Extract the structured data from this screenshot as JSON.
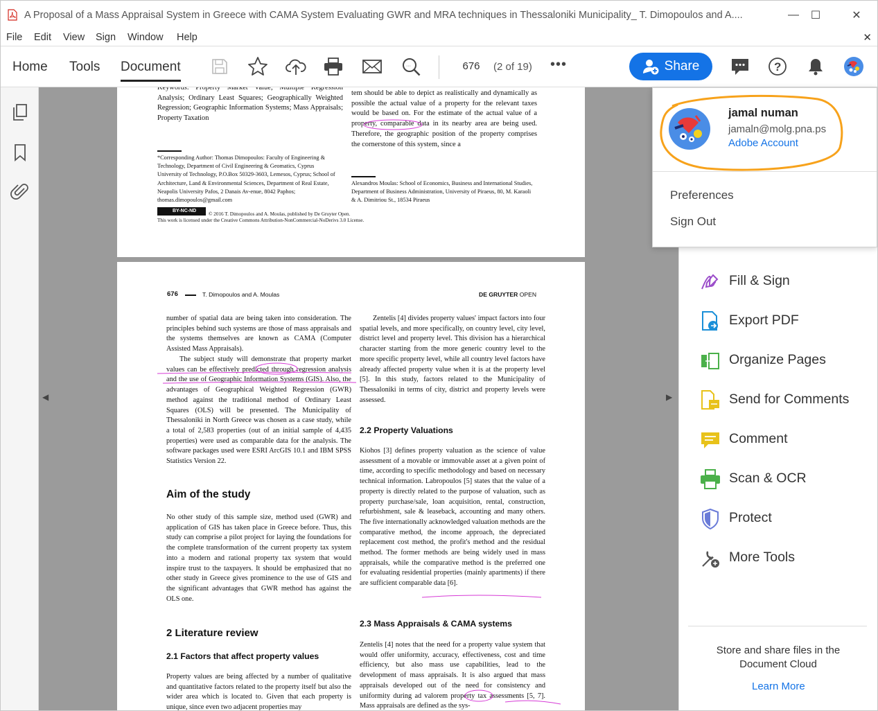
{
  "window": {
    "title": "A Proposal of a Mass Appraisal System in Greece with CAMA System Evaluating GWR and MRA techniques in Thessaloniki Municipality_ T. Dimopoulos and A....",
    "minimize": "—",
    "maximize": "☐",
    "close": "✕"
  },
  "menu": {
    "items": [
      "File",
      "Edit",
      "View",
      "Sign",
      "Window",
      "Help"
    ],
    "close_doc": "✕"
  },
  "toolbar": {
    "tabs": [
      "Home",
      "Tools",
      "Document"
    ],
    "active_tab": "Document",
    "page_number": "676",
    "page_count": "(2 of 19)",
    "more": "•••",
    "share_label": "Share"
  },
  "account_popup": {
    "name": "jamal numan",
    "email": "jamaln@molg.pna.ps",
    "account_link": "Adobe Account",
    "preferences": "Preferences",
    "sign_out": "Sign Out",
    "highlight_color": "#f7a21b"
  },
  "tools_panel": {
    "items": [
      {
        "label": "Fill & Sign",
        "icon": "fill-sign-icon",
        "color": "#9b4dca"
      },
      {
        "label": "Export PDF",
        "icon": "export-pdf-icon",
        "color": "#1a8fd8"
      },
      {
        "label": "Organize Pages",
        "icon": "organize-pages-icon",
        "color": "#4bb04a"
      },
      {
        "label": "Send for Comments",
        "icon": "send-comments-icon",
        "color": "#e8c21a"
      },
      {
        "label": "Comment",
        "icon": "comment-icon",
        "color": "#e8c21a"
      },
      {
        "label": "Scan & OCR",
        "icon": "scan-ocr-icon",
        "color": "#4bb04a"
      },
      {
        "label": "Protect",
        "icon": "protect-icon",
        "color": "#6a7bd8"
      },
      {
        "label": "More Tools",
        "icon": "more-tools-icon",
        "color": "#555555"
      }
    ],
    "cloud_text": "Store and share files in the Document Cloud",
    "learn_more": "Learn More"
  },
  "page1": {
    "keywords": "Keywords: Property Market Value; Multiple Regression Analysis; Ordinary Least Squares; Geographically Weighted Regression; Geographic Information Systems; Mass Appraisals; Property Taxation",
    "right_text": "tem should be able to depict as realistically and dynamically as possible the actual value of a property for the relevant taxes would be based on. For the estimate of the actual value of a property, comparable data in its nearby area are being used. Therefore, the geographic position of the property comprises the cornerstone of this system, since a",
    "corr_author": "*Corresponding Author: Thomas Dimopoulos: Faculty of Engineering & Technology, Department of Civil Engineering & Geomatics, Cyprus University of Technology, P.O.Box 50329-3603, Lemesos, Cyprus; School of Architecture, Land & Environmental Sciences, Department of Real Estate, Neapolis University Pafos, 2 Danais Av-enue, 8042 Paphos; thomas.dimopoulos@gmail.com",
    "second_author": "Alexandros Moulas: School of Economics, Business and International Studies, Department of Business Administration, University of Piraeus, 80, M. Karaoli & A. Dimitriou St., 18534 Piraeus",
    "license_badge": "BY-NC-ND",
    "license_line1": "© 2016 T. Dimopoulos and A. Moulas, published by De Gruyter Open.",
    "license_line2": "This work is licensed under the Creative Commons Attribution-NonCommercial-NoDerivs 3.0 License."
  },
  "page2": {
    "page_num": "676",
    "authors": "T. Dimopoulos and A. Moulas",
    "publisher_bold": "DE GRUYTER",
    "publisher_light": "OPEN",
    "left_p1": "number of spatial data are being taken into consideration. The principles behind such systems are those of mass appraisals and the systems themselves are known as CAMA (Computer Assisted Mass Appraisals).",
    "left_p2": "The subject study will demonstrate that property market values can be effectively predicted through regression analysis and the use of Geographic Information Systems (GIS). Also, the advantages of Geographical Weighted Regression (GWR) method against the traditional method of Ordinary Least Squares (OLS) will be presented. The Municipality of Thessaloniki in North Greece was chosen as a case study, while a total of 2,583 properties (out of an initial sample of 4,435 properties) were used as comparable data for the analysis. The software packages used were ESRI ArcGIS 10.1 and IBM SPSS Statistics Version 22.",
    "aim_heading": "Aim of the study",
    "aim_text": "No other study of this sample size, method used (GWR) and application of GIS has taken place in Greece before. Thus, this study can comprise a pilot project for laying the foundations for the complete transformation of the current property tax system into a modern and rational property tax system that would inspire trust to the taxpayers. It should be emphasized that no other study in Greece gives prominence to the use of GIS and the significant advantages that GWR method has against the OLS one.",
    "lit_heading": "2  Literature review",
    "lit_sub": "2.1  Factors that affect property values",
    "lit_text": "Property values are being affected by a number of qualitative and quantitative factors related to the property itself but also the wider area which is located to. Given that each property is unique, since even two adjacent properties may",
    "right_p1": "Zentelis [4] divides property values' impact factors into four spatial levels, and more specifically, on country level, city level, district level and property level. This division has a hierarchical character starting from the more generic country level to the more specific property level, while all country level factors have already affected property value when it is at the property level [5]. In this study, factors related to the Municipality of Thessaloniki in terms of city, district and property levels were assessed.",
    "val_heading": "2.2  Property Valuations",
    "val_text": "Kiohos [3] defines property valuation as the science of value assessment of a movable or immovable asset at a given point of time, according to specific methodology and based on necessary technical information. Labropoulos [5] states that the value of a property is directly related to the purpose of valuation, such as property purchase/sale, loan acquisition, rental, construction, refurbishment, sale & leaseback, accounting and many others. The five internationally acknowledged valuation methods are the comparative method, the income approach, the depreciated replacement cost method, the profit's method and the residual method. The former methods are being widely used in mass appraisals, while the comparative method is the preferred one for evaluating residential properties (mainly apartments) if there are sufficient comparable data [6].",
    "cama_heading": "2.3  Mass Appraisals & CAMA systems",
    "cama_text": "Zentelis [4] notes that the need for a property value system that would offer uniformity, accuracy, effectiveness, cost and time efficiency, but also mass use capabilities, lead to the development of mass appraisals. It is also argued that mass appraisals developed out of the need for consistency and uniformity during ad valorem property tax assessments [5, 7]. Mass appraisals are defined as the sys-"
  }
}
